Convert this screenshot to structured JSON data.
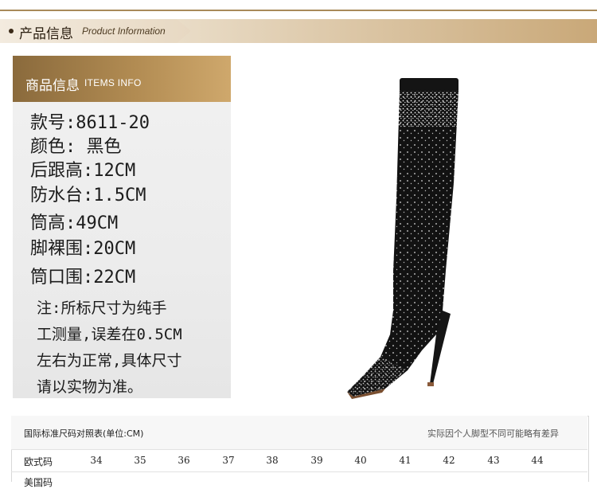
{
  "banner": {
    "title_cn": "产品信息",
    "title_en": "Product Information"
  },
  "info_card": {
    "header_cn": "商品信息",
    "header_en": "ITEMS INFO",
    "specs": [
      "款号:8611-20",
      "颜色: 黑色",
      "后跟高:12CM",
      "防水台:1.5CM",
      "筒高:49CM",
      "脚裸围:20CM",
      "筒口围:22CM"
    ],
    "note_lines": [
      "注:所标尺寸为纯手",
      "工测量,误差在0.5CM",
      "左右为正常,具体尺寸",
      "请以实物为准。"
    ]
  },
  "product_image": {
    "icon": "over-knee-rhinestone-boot",
    "color": "#111111"
  },
  "size_table": {
    "title": "国际标准尺码对照表(单位:CM)",
    "note": "实际因个人脚型不同可能略有差异",
    "rows": [
      {
        "label": "欧式码",
        "values": [
          "34",
          "35",
          "36",
          "37",
          "38",
          "39",
          "40",
          "41",
          "42",
          "43",
          "44"
        ]
      },
      {
        "label": "美国码",
        "values": [
          "",
          "",
          "",
          "",
          "",
          "",
          "",
          "",
          "",
          "",
          ""
        ]
      }
    ]
  },
  "colors": {
    "accent_gold": "#b18b52",
    "banner_light": "#efe4d4"
  }
}
